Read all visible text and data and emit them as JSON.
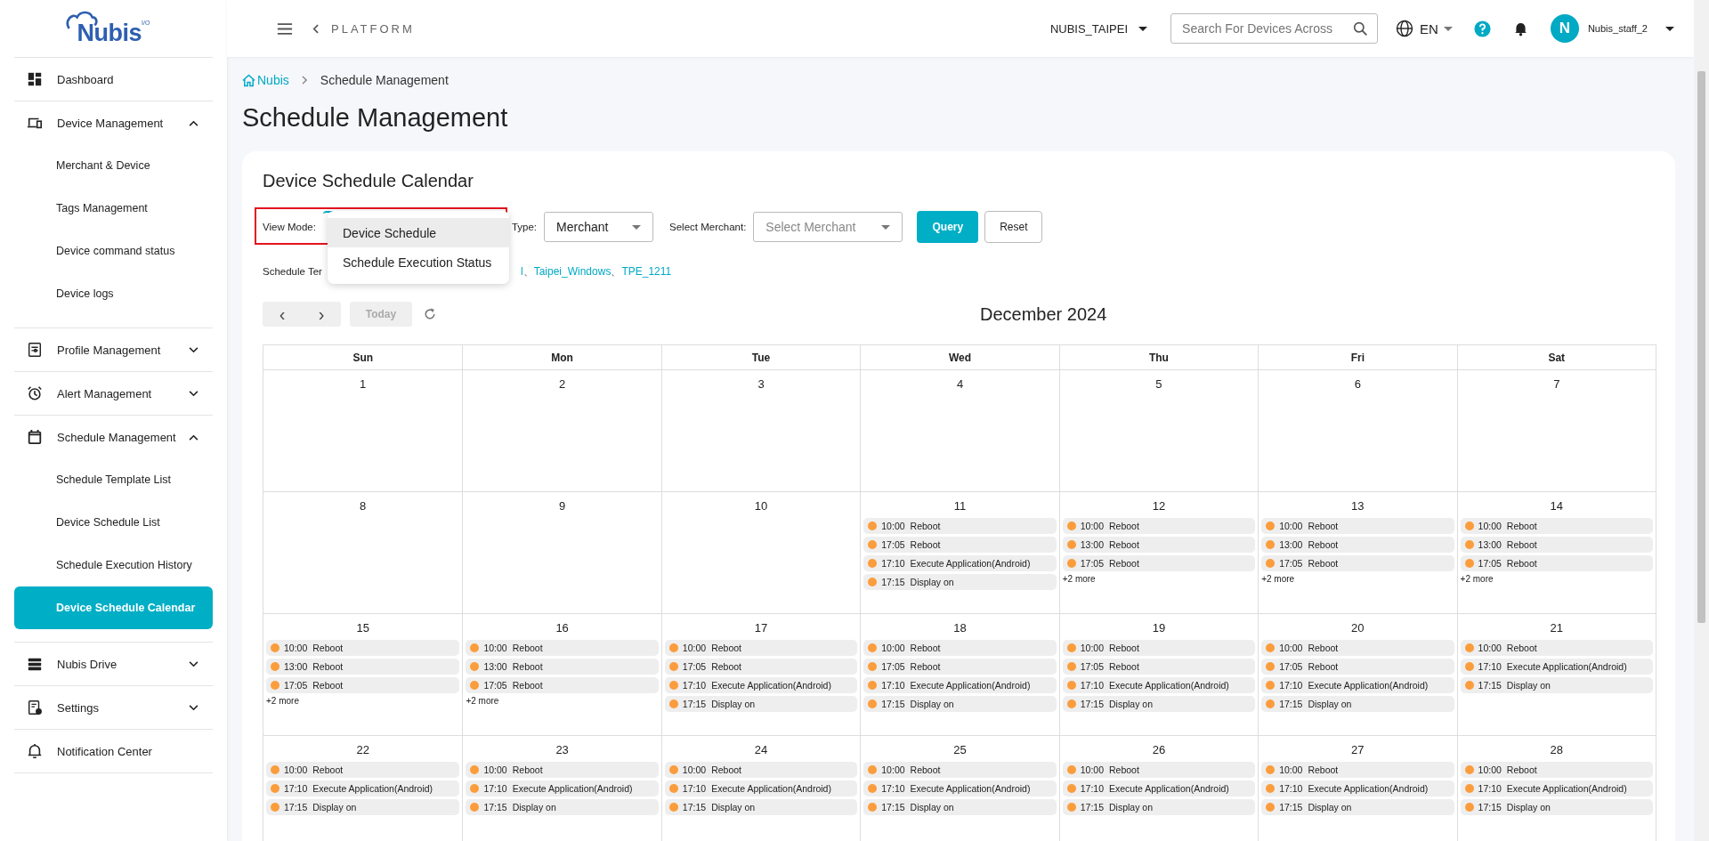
{
  "logo": {
    "text": "Nubis",
    "superscript": "I/O"
  },
  "sidebar": {
    "items": [
      {
        "label": "Dashboard",
        "kind": "link"
      },
      {
        "label": "Device Management",
        "kind": "group",
        "expanded": true,
        "children": [
          {
            "label": "Merchant & Device",
            "selected": false
          },
          {
            "label": "Tags Management",
            "selected": false
          },
          {
            "label": "Device command status",
            "selected": false
          },
          {
            "label": "Device logs",
            "selected": false
          }
        ]
      },
      {
        "label": "Profile Management",
        "kind": "group",
        "expanded": false
      },
      {
        "label": "Alert Management",
        "kind": "group",
        "expanded": false
      },
      {
        "label": "Schedule Management",
        "kind": "group",
        "expanded": true,
        "children": [
          {
            "label": "Schedule Template List",
            "selected": false
          },
          {
            "label": "Device Schedule List",
            "selected": false
          },
          {
            "label": "Schedule Execution History",
            "selected": false
          },
          {
            "label": "Device Schedule Calendar",
            "selected": true
          }
        ]
      },
      {
        "label": "Nubis Drive",
        "kind": "group",
        "expanded": false
      },
      {
        "label": "Settings",
        "kind": "group",
        "expanded": false
      },
      {
        "label": "Notification Center",
        "kind": "link"
      }
    ]
  },
  "header": {
    "back_label": "PLATFORM",
    "org": "NUBIS_TAIPEI",
    "search": {
      "placeholder": "Search For Devices Across"
    },
    "language": "EN",
    "avatar": "N",
    "user": "Nubis_staff_2"
  },
  "breadcrumb": {
    "home": "Nubis",
    "current": "Schedule Management"
  },
  "page_title": "Schedule Management",
  "card": {
    "title": "Device Schedule Calendar",
    "filters": {
      "view_mode_label": "View Mode:",
      "view_mode_options": [
        {
          "label": "Device Schedule",
          "selected": true
        },
        {
          "label": "Schedule Execution Status",
          "selected": false
        }
      ],
      "type_label": "Type:",
      "type_value": "Merchant",
      "merchant_label": "Select Merchant:",
      "merchant_placeholder": "Select Merchant",
      "query": "Query",
      "reset": "Reset"
    },
    "templates": {
      "label": "Schedule Ter",
      "separator": "、",
      "links": [
        "l",
        "Taipei_Windows",
        "TPE_1211"
      ]
    },
    "toolbar": {
      "prev": "‹",
      "next": "›",
      "today": "Today",
      "today_disabled": true,
      "month": "December 2024"
    },
    "calendar": {
      "weekdays": [
        "Sun",
        "Mon",
        "Tue",
        "Wed",
        "Thu",
        "Fri",
        "Sat"
      ],
      "weeks": [
        [
          {
            "day": "1"
          },
          {
            "day": "2"
          },
          {
            "day": "3"
          },
          {
            "day": "4"
          },
          {
            "day": "5"
          },
          {
            "day": "6"
          },
          {
            "day": "7"
          }
        ],
        [
          {
            "day": "8"
          },
          {
            "day": "9"
          },
          {
            "day": "10"
          },
          {
            "day": "11",
            "events": [
              {
                "time": "10:00",
                "title": "Reboot"
              },
              {
                "time": "17:05",
                "title": "Reboot"
              },
              {
                "time": "17:10",
                "title": "Execute Application(Android)"
              },
              {
                "time": "17:15",
                "title": "Display on"
              }
            ]
          },
          {
            "day": "12",
            "events": [
              {
                "time": "10:00",
                "title": "Reboot"
              },
              {
                "time": "13:00",
                "title": "Reboot"
              },
              {
                "time": "17:05",
                "title": "Reboot"
              }
            ],
            "more": "+2 more"
          },
          {
            "day": "13",
            "events": [
              {
                "time": "10:00",
                "title": "Reboot"
              },
              {
                "time": "13:00",
                "title": "Reboot"
              },
              {
                "time": "17:05",
                "title": "Reboot"
              }
            ],
            "more": "+2 more"
          },
          {
            "day": "14",
            "events": [
              {
                "time": "10:00",
                "title": "Reboot"
              },
              {
                "time": "13:00",
                "title": "Reboot"
              },
              {
                "time": "17:05",
                "title": "Reboot"
              }
            ],
            "more": "+2 more"
          }
        ],
        [
          {
            "day": "15",
            "events": [
              {
                "time": "10:00",
                "title": "Reboot"
              },
              {
                "time": "13:00",
                "title": "Reboot"
              },
              {
                "time": "17:05",
                "title": "Reboot"
              }
            ],
            "more": "+2 more"
          },
          {
            "day": "16",
            "events": [
              {
                "time": "10:00",
                "title": "Reboot"
              },
              {
                "time": "13:00",
                "title": "Reboot"
              },
              {
                "time": "17:05",
                "title": "Reboot"
              }
            ],
            "more": "+2 more"
          },
          {
            "day": "17",
            "events": [
              {
                "time": "10:00",
                "title": "Reboot"
              },
              {
                "time": "17:05",
                "title": "Reboot"
              },
              {
                "time": "17:10",
                "title": "Execute Application(Android)"
              },
              {
                "time": "17:15",
                "title": "Display on"
              }
            ]
          },
          {
            "day": "18",
            "events": [
              {
                "time": "10:00",
                "title": "Reboot"
              },
              {
                "time": "17:05",
                "title": "Reboot"
              },
              {
                "time": "17:10",
                "title": "Execute Application(Android)"
              },
              {
                "time": "17:15",
                "title": "Display on"
              }
            ]
          },
          {
            "day": "19",
            "events": [
              {
                "time": "10:00",
                "title": "Reboot"
              },
              {
                "time": "17:05",
                "title": "Reboot"
              },
              {
                "time": "17:10",
                "title": "Execute Application(Android)"
              },
              {
                "time": "17:15",
                "title": "Display on"
              }
            ]
          },
          {
            "day": "20",
            "events": [
              {
                "time": "10:00",
                "title": "Reboot"
              },
              {
                "time": "17:05",
                "title": "Reboot"
              },
              {
                "time": "17:10",
                "title": "Execute Application(Android)"
              },
              {
                "time": "17:15",
                "title": "Display on"
              }
            ]
          },
          {
            "day": "21",
            "events": [
              {
                "time": "10:00",
                "title": "Reboot"
              },
              {
                "time": "17:10",
                "title": "Execute Application(Android)"
              },
              {
                "time": "17:15",
                "title": "Display on"
              }
            ]
          }
        ],
        [
          {
            "day": "22",
            "events": [
              {
                "time": "10:00",
                "title": "Reboot"
              },
              {
                "time": "17:10",
                "title": "Execute Application(Android)"
              },
              {
                "time": "17:15",
                "title": "Display on"
              }
            ]
          },
          {
            "day": "23",
            "events": [
              {
                "time": "10:00",
                "title": "Reboot"
              },
              {
                "time": "17:10",
                "title": "Execute Application(Android)"
              },
              {
                "time": "17:15",
                "title": "Display on"
              }
            ]
          },
          {
            "day": "24",
            "events": [
              {
                "time": "10:00",
                "title": "Reboot"
              },
              {
                "time": "17:10",
                "title": "Execute Application(Android)"
              },
              {
                "time": "17:15",
                "title": "Display on"
              }
            ]
          },
          {
            "day": "25",
            "events": [
              {
                "time": "10:00",
                "title": "Reboot"
              },
              {
                "time": "17:10",
                "title": "Execute Application(Android)"
              },
              {
                "time": "17:15",
                "title": "Display on"
              }
            ]
          },
          {
            "day": "26",
            "events": [
              {
                "time": "10:00",
                "title": "Reboot"
              },
              {
                "time": "17:10",
                "title": "Execute Application(Android)"
              },
              {
                "time": "17:15",
                "title": "Display on"
              }
            ]
          },
          {
            "day": "27",
            "events": [
              {
                "time": "10:00",
                "title": "Reboot"
              },
              {
                "time": "17:10",
                "title": "Execute Application(Android)"
              },
              {
                "time": "17:15",
                "title": "Display on"
              }
            ]
          },
          {
            "day": "28",
            "events": [
              {
                "time": "10:00",
                "title": "Reboot"
              },
              {
                "time": "17:10",
                "title": "Execute Application(Android)"
              },
              {
                "time": "17:15",
                "title": "Display on"
              }
            ]
          }
        ]
      ]
    }
  }
}
